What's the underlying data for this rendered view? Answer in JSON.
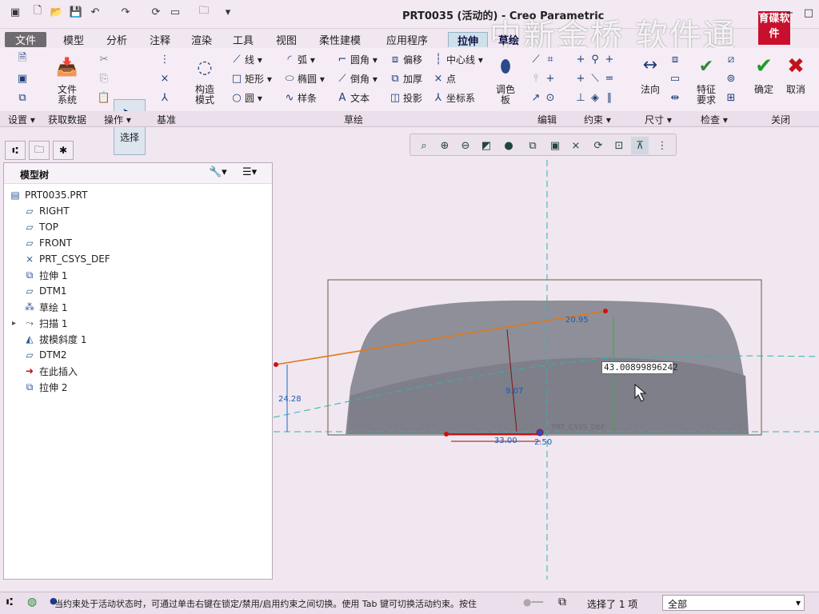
{
  "window": {
    "title": "PRT0035 (活动的) - Creo Parametric",
    "minimize": "−",
    "maximize": "□",
    "close": "×"
  },
  "quick_access": {
    "icons": [
      "new-file-icon",
      "open-icon",
      "save-icon",
      "undo-icon",
      "redo-icon",
      "regenerate-icon",
      "window-icon",
      "close-window-icon",
      "customize-icon"
    ]
  },
  "menu": {
    "tabs": [
      "文件",
      "模型",
      "分析",
      "注释",
      "渲染",
      "工具",
      "视图",
      "柔性建模",
      "应用程序",
      "拉伸",
      "草绘"
    ]
  },
  "watermark": {
    "text": "中新金桥 软件通",
    "logo": "育碟软件"
  },
  "ribbon": {
    "file_system": "文件\n系统",
    "select": "选择",
    "construct_mode": "构造\n模式",
    "palette": "调色\n板",
    "sketch_items": {
      "line": "线",
      "arc": "弧",
      "fillet": "圆角",
      "offset": "偏移",
      "centerline": "中心线",
      "rectangle": "矩形",
      "ellipse": "椭圆",
      "chamfer": "倒角",
      "thicken": "加厚",
      "point": "点",
      "circle": "圆",
      "spline": "样条",
      "text": "文本",
      "project": "投影",
      "coordsys": "坐标系"
    },
    "normal": "法向",
    "feature_req": "特征\n要求",
    "ok": "确定",
    "cancel": "取消",
    "groups": [
      "设置",
      "获取数据",
      "操作",
      "基准",
      "草绘",
      "编辑",
      "约束",
      "尺寸",
      "检查",
      "关闭"
    ]
  },
  "model_tree": {
    "title": "模型树",
    "items": [
      {
        "label": "PRT0035.PRT",
        "icon": "part-icon"
      },
      {
        "label": "RIGHT",
        "icon": "datum-plane-icon"
      },
      {
        "label": "TOP",
        "icon": "datum-plane-icon"
      },
      {
        "label": "FRONT",
        "icon": "datum-plane-icon"
      },
      {
        "label": "PRT_CSYS_DEF",
        "icon": "csys-icon"
      },
      {
        "label": "拉伸 1",
        "icon": "extrude-icon"
      },
      {
        "label": "DTM1",
        "icon": "datum-plane-icon"
      },
      {
        "label": "草绘 1",
        "icon": "sketch-icon"
      },
      {
        "label": "扫描 1",
        "icon": "sweep-icon"
      },
      {
        "label": "拔模斜度 1",
        "icon": "draft-icon"
      },
      {
        "label": "DTM2",
        "icon": "datum-plane-icon"
      },
      {
        "label": "在此插入",
        "icon": "insert-arrow-icon"
      },
      {
        "label": "拉伸 2",
        "icon": "extrude-icon"
      }
    ]
  },
  "sketch": {
    "dims": {
      "d1": "20.95",
      "d2": "9.07",
      "d3": "24.28",
      "d4": "33.00",
      "d5": "2.50"
    },
    "csys_label": "PRT_CSYS_DEF",
    "edit_value": "43.00899896242"
  },
  "status": {
    "message": "当约束处于活动状态时，可通过单击右键在锁定/禁用/启用约束之间切换。使用 Tab 键可切换活动约束。按住",
    "selected": "选择了 1 项",
    "filter": "全部"
  }
}
